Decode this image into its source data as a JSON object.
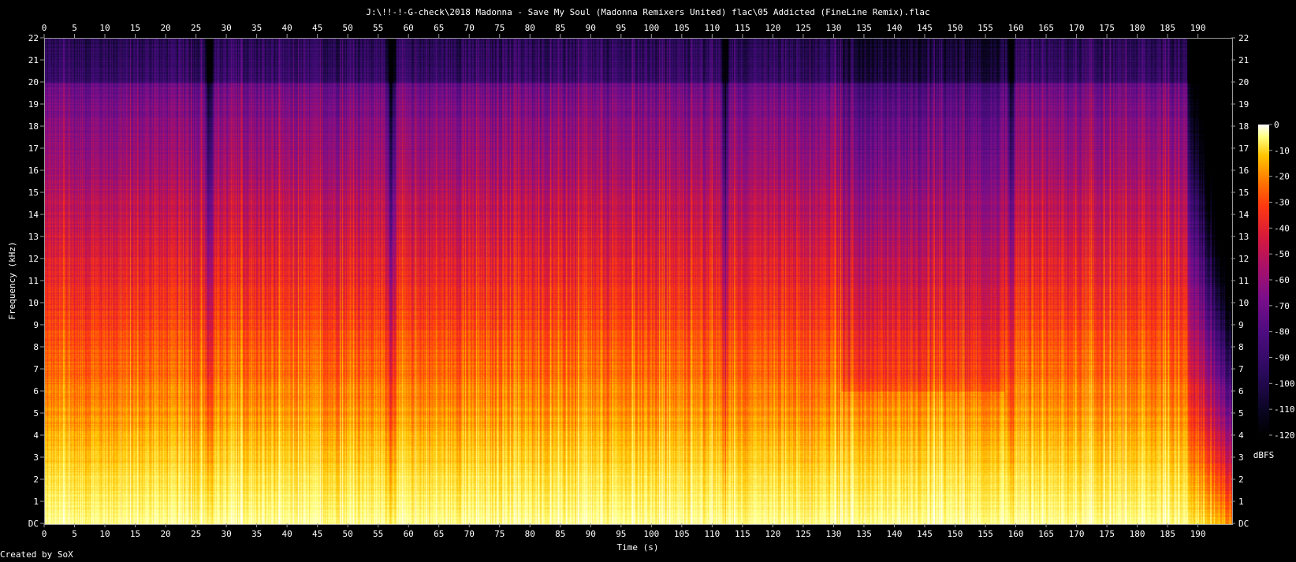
{
  "window": {
    "title": "J:\\!!-!-G-check\\2018 Madonna - Save My Soul (Madonna Remixers United) flac\\05 Addicted (FineLine Remix).flac",
    "footer": "Created by SoX"
  },
  "chart_data": {
    "type": "heatmap",
    "title": "J:\\!!-!-G-check\\2018 Madonna - Save My Soul (Madonna Remixers United) flac\\05 Addicted (FineLine Remix).flac",
    "xlabel": "Time (s)",
    "ylabel": "Frequency (kHz)",
    "xlim": [
      0,
      195.5
    ],
    "ylim": [
      0,
      22
    ],
    "x_ticks": [
      "0",
      "5",
      "10",
      "15",
      "20",
      "25",
      "30",
      "35",
      "40",
      "45",
      "50",
      "55",
      "60",
      "65",
      "70",
      "75",
      "80",
      "85",
      "90",
      "95",
      "100",
      "105",
      "110",
      "115",
      "120",
      "125",
      "130",
      "135",
      "140",
      "145",
      "150",
      "155",
      "160",
      "165",
      "170",
      "175",
      "180",
      "185",
      "190"
    ],
    "y_ticks": [
      "DC",
      "1",
      "2",
      "3",
      "4",
      "5",
      "6",
      "7",
      "8",
      "9",
      "10",
      "11",
      "12",
      "13",
      "14",
      "15",
      "16",
      "17",
      "18",
      "19",
      "20",
      "21",
      "22"
    ],
    "colorbar": {
      "label": "dBFS",
      "ticks": [
        "0",
        "-10",
        "-20",
        "-30",
        "-40",
        "-50",
        "-60",
        "-70",
        "-80",
        "-90",
        "-100",
        "-110",
        "-120"
      ],
      "range": [
        -120,
        0
      ]
    },
    "features": {
      "track_end_s": 188,
      "quiet_gaps_s": [
        27,
        57,
        112,
        159
      ],
      "bass_band_top_khz": 5,
      "upper_cutoff_khz": 20
    }
  }
}
